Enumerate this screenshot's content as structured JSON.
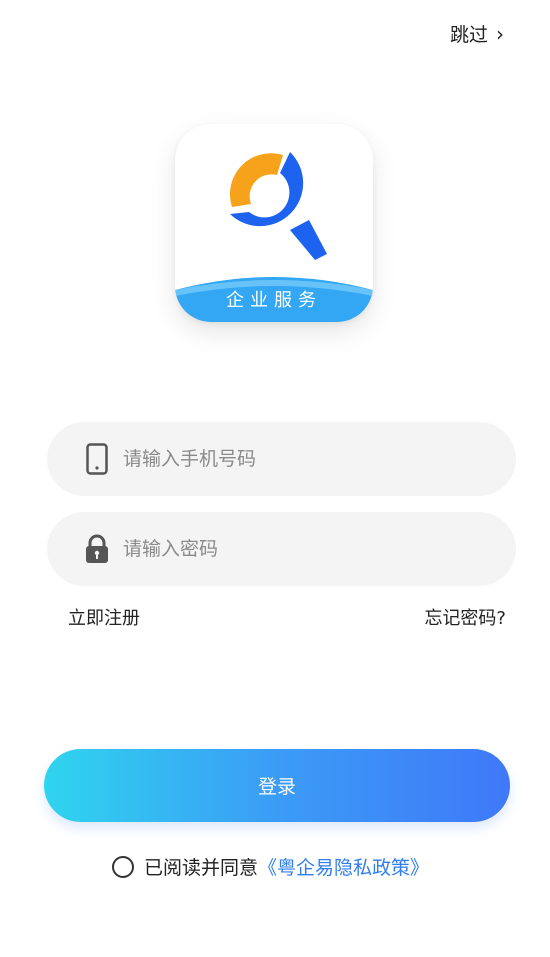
{
  "header": {
    "skip_label": "跳过",
    "skip_chevron": "›"
  },
  "logo": {
    "text": "企业服务",
    "colors": {
      "orange": "#f7a21b",
      "blue": "#1e63f0",
      "band": "#33a6f4"
    }
  },
  "form": {
    "phone_placeholder": "请输入手机号码",
    "password_placeholder": "请输入密码",
    "phone_icon": "phone-icon",
    "lock_icon": "lock-icon"
  },
  "links": {
    "register": "立即注册",
    "forgot": "忘记密码?"
  },
  "login": {
    "label": "登录"
  },
  "agreement": {
    "prefix": "已阅读并同意",
    "policy": "《粤企易隐私政策》",
    "checked": false
  }
}
